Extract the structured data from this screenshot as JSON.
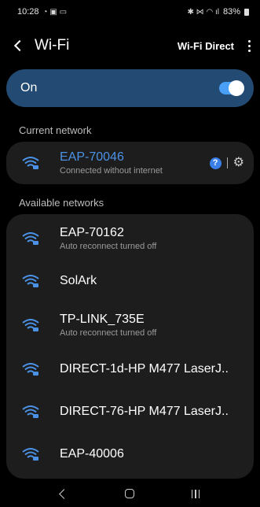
{
  "status_bar": {
    "time": "10:28",
    "battery": "83%"
  },
  "app_bar": {
    "title": "Wi-Fi",
    "wifi_direct_label": "Wi-Fi Direct"
  },
  "toggle": {
    "label": "On",
    "enabled": true
  },
  "current_network": {
    "header": "Current network",
    "name": "EAP-70046",
    "status": "Connected without internet",
    "help_glyph": "?"
  },
  "available": {
    "header": "Available networks",
    "networks": [
      {
        "name": "EAP-70162",
        "status": "Auto reconnect turned off"
      },
      {
        "name": "SolArk",
        "status": ""
      },
      {
        "name": "TP-LINK_735E",
        "status": "Auto reconnect turned off"
      },
      {
        "name": "DIRECT-1d-HP M477 LaserJ..",
        "status": ""
      },
      {
        "name": "DIRECT-76-HP M477 LaserJ..",
        "status": ""
      },
      {
        "name": "EAP-40006",
        "status": ""
      }
    ]
  },
  "icons": {
    "wifi": "wifi-lock-icon",
    "settings": "gear-icon",
    "help": "help-icon"
  },
  "colors": {
    "accent": "#4b92e6",
    "toggle_card": "#234a73",
    "card_bg": "#1d1d1d"
  }
}
